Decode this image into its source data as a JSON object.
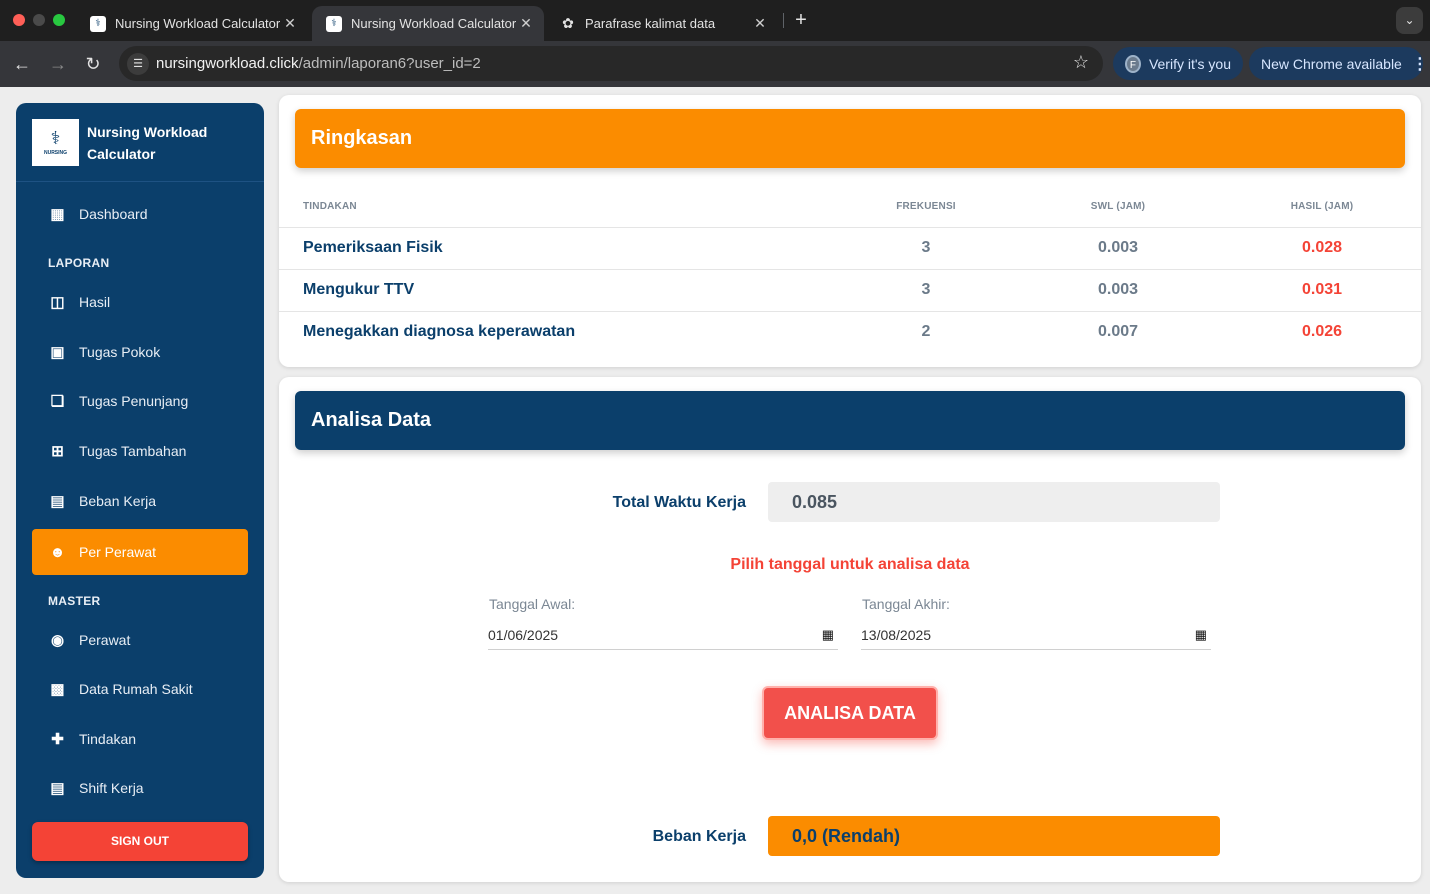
{
  "browser": {
    "tabs": [
      {
        "title": "Nursing Workload Calculator",
        "active": false
      },
      {
        "title": "Nursing Workload Calculator",
        "active": true
      },
      {
        "title": "Parafrase kalimat data",
        "active": false
      }
    ],
    "url_host": "nursingworkload.click",
    "url_path": "/admin/laporan6?user_id=2",
    "verify_label": "Verify it's you",
    "verify_avatar": "F",
    "update_label": "New Chrome available"
  },
  "sidebar": {
    "brand": "Nursing Workload Calculator",
    "logo_text": "NURSING",
    "dashboard": "Dashboard",
    "section_laporan": "LAPORAN",
    "laporan_items": [
      "Hasil",
      "Tugas Pokok",
      "Tugas Penunjang",
      "Tugas Tambahan",
      "Beban Kerja",
      "Per Perawat"
    ],
    "section_master": "MASTER",
    "master_items": [
      "Perawat",
      "Data Rumah Sakit",
      "Tindakan",
      "Shift Kerja"
    ],
    "signout": "SIGN OUT",
    "active_item": "Per Perawat",
    "accent_color": "#fb8c00",
    "bg_color": "#0b3f6b"
  },
  "ringkasan": {
    "title": "Ringkasan",
    "columns": [
      "TINDAKAN",
      "FREKUENSI",
      "SWL (JAM)",
      "HASIL (JAM)"
    ],
    "rows": [
      {
        "tindakan": "Pemeriksaan Fisik",
        "frekuensi": "3",
        "swl": "0.003",
        "hasil": "0.028"
      },
      {
        "tindakan": "Mengukur TTV",
        "frekuensi": "3",
        "swl": "0.003",
        "hasil": "0.031"
      },
      {
        "tindakan": "Menegakkan diagnosa keperawatan",
        "frekuensi": "2",
        "swl": "0.007",
        "hasil": "0.026"
      }
    ]
  },
  "analisa": {
    "title": "Analisa Data",
    "total_label": "Total Waktu Kerja",
    "total_value": "0.085",
    "hint": "Pilih tanggal untuk analisa data",
    "start_label": "Tanggal Awal:",
    "start_value": "01/06/2025",
    "end_label": "Tanggal Akhir:",
    "end_value": "13/08/2025",
    "button": "ANALISA DATA",
    "beban_label": "Beban Kerja",
    "beban_value": "0,0 (Rendah)"
  }
}
